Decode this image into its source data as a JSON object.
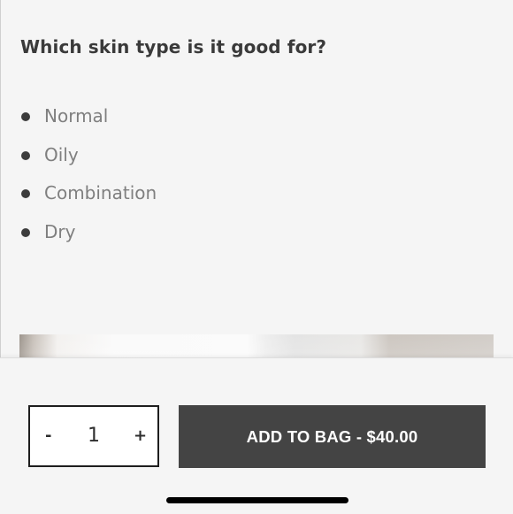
{
  "question": "Which skin type is it good for?",
  "skin_types": [
    "Normal",
    "Oily",
    "Combination",
    "Dry"
  ],
  "footer": {
    "quantity": {
      "minus_label": "-",
      "value": "1",
      "plus_label": "+"
    },
    "add_to_bag_label": "ADD TO BAG - $40.00"
  },
  "colors": {
    "background": "#f5f5f5",
    "button": "#444444",
    "button_text": "#ffffff",
    "list_text": "#7f7f7f",
    "heading_text": "#3a3a3a"
  }
}
